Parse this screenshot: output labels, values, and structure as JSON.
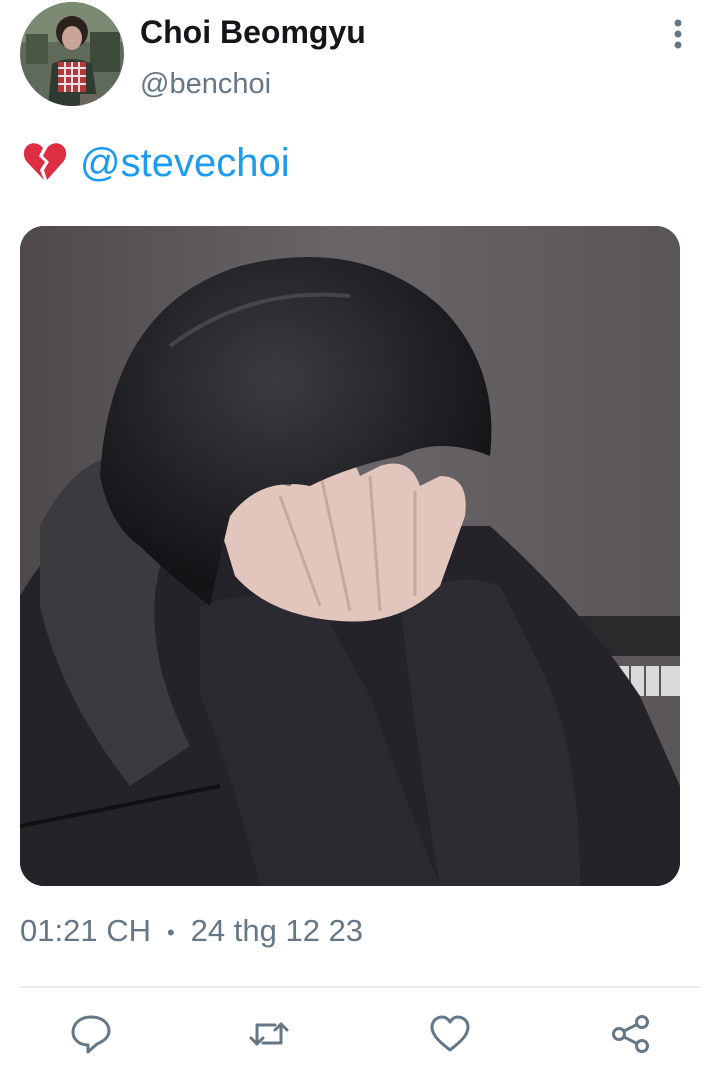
{
  "tweet": {
    "author_name": "Choi Beomgyu",
    "author_handle": "@benchoi",
    "emoji": "broken-heart",
    "mention": "@stevechoi",
    "time": "01:21 CH",
    "separator": "•",
    "date": "24 thg 12 23"
  },
  "icons": {
    "more": "more-vertical-icon",
    "reply": "reply-icon",
    "retweet": "retweet-icon",
    "like": "like-icon",
    "share": "share-icon"
  },
  "colors": {
    "link": "#1d9bf0",
    "secondary_text": "#657786",
    "primary_text": "#14171a",
    "divider": "#e6ecf0"
  }
}
